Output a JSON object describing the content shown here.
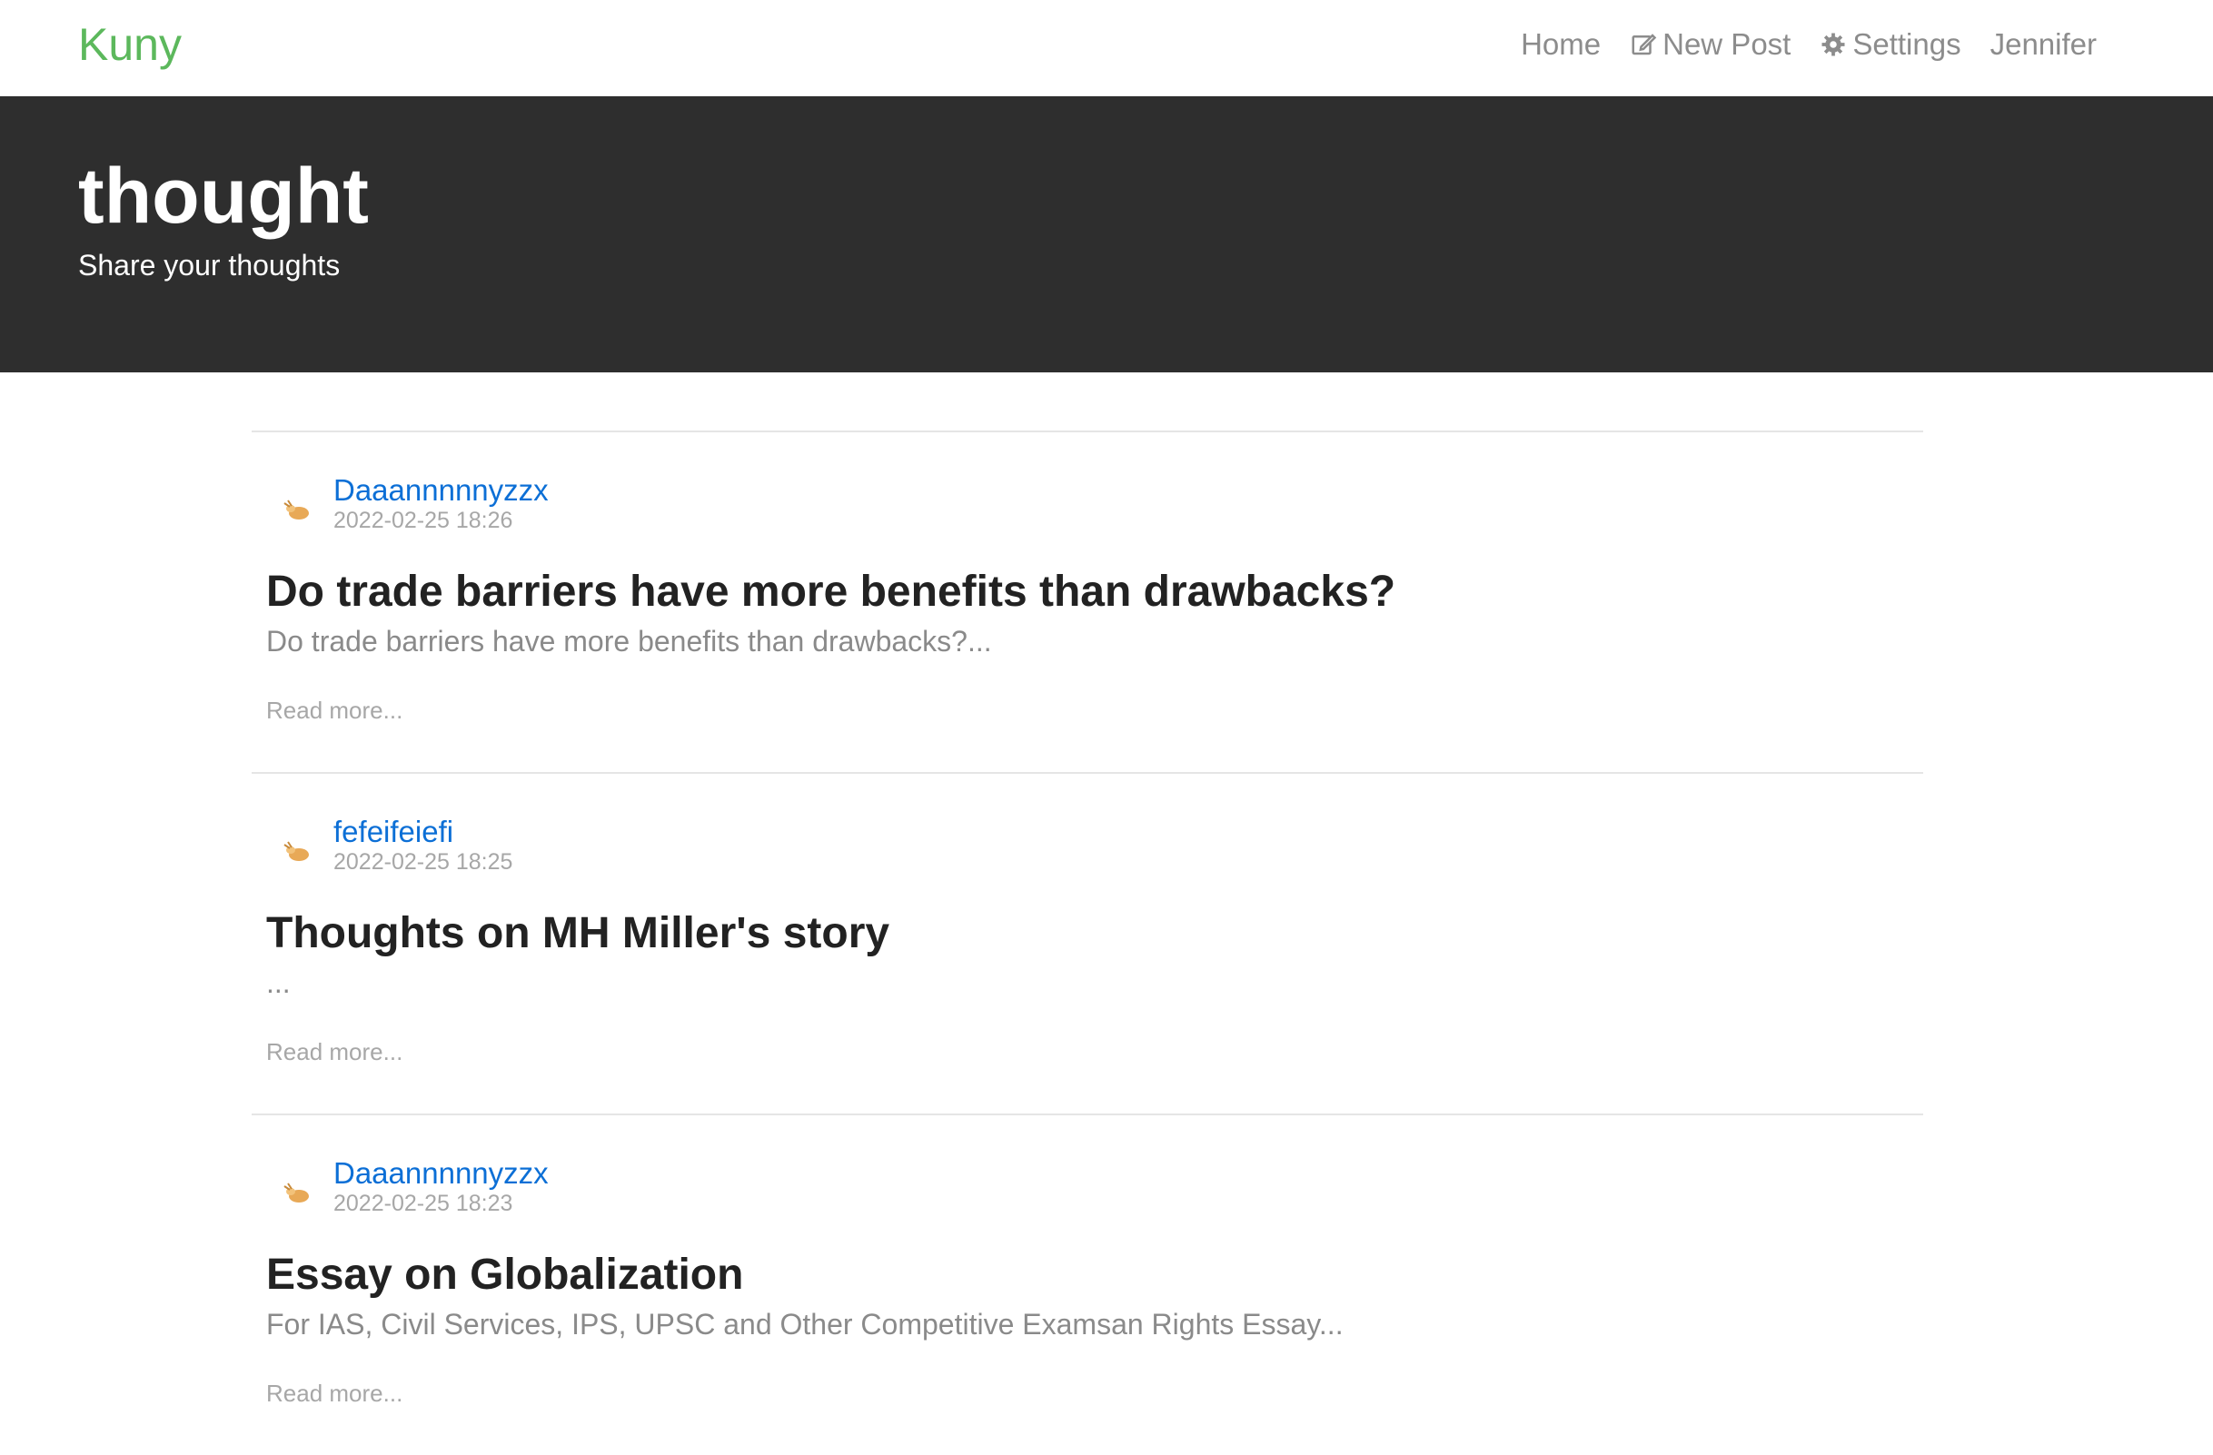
{
  "navbar": {
    "brand": "Kuny",
    "brand_color": "#5cb85c",
    "links": [
      {
        "label": "Home",
        "icon": ""
      },
      {
        "label": "New Post",
        "icon": "edit-icon"
      },
      {
        "label": "Settings",
        "icon": "gear-icon"
      },
      {
        "label": "Jennifer",
        "icon": ""
      }
    ]
  },
  "banner": {
    "title": "thought",
    "subtitle": "Share your thoughts",
    "background": "#2e2e2e"
  },
  "articles": [
    {
      "author": "Daaannnnnyzzx",
      "date": "2022-02-25 18:26",
      "avatar": "avatar-icon",
      "title": "Do trade barriers have more benefits than drawbacks?",
      "excerpt": "Do trade barriers have more benefits than drawbacks?...",
      "read_more": "Read more..."
    },
    {
      "author": "fefeifeiefi",
      "date": "2022-02-25 18:25",
      "avatar": "avatar-icon",
      "title": "Thoughts on MH Miller's story",
      "excerpt": "...",
      "read_more": "Read more..."
    },
    {
      "author": "Daaannnnnyzzx",
      "date": "2022-02-25 18:23",
      "avatar": "avatar-icon",
      "title": "Essay on Globalization",
      "excerpt": "For IAS, Civil Services, IPS, UPSC and Other Competitive Examsan Rights Essay...",
      "read_more": "Read more..."
    }
  ],
  "colors": {
    "author_link": "#0c6fd6",
    "muted_text": "#8a8a8a"
  }
}
